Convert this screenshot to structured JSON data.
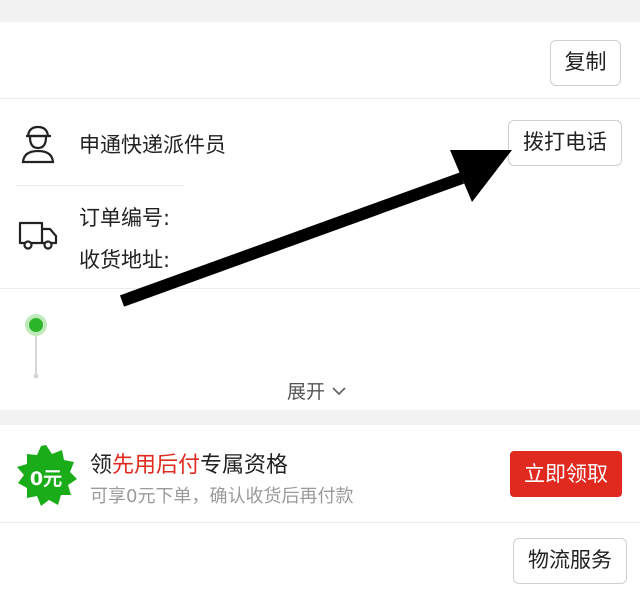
{
  "top_card": {
    "copy_label": "复制",
    "courier_label": "申通快递派件员",
    "call_label": "拨打电话",
    "order_no_label": "订单编号:",
    "address_label": "收货地址:",
    "expand_label": "展开"
  },
  "promo": {
    "badge_text": "0元",
    "title_prefix": "领",
    "title_highlight": "先用后付",
    "title_suffix": "专属资格",
    "subtitle": "可享0元下单，确认收货后再付款",
    "claim_label": "立即领取"
  },
  "footer": {
    "logistics_label": "物流服务"
  },
  "colors": {
    "accent_red": "#e02a20",
    "badge_green": "#1aad19",
    "status_green": "#2bb52b"
  },
  "icons": {
    "courier": "courier-person-icon",
    "truck": "delivery-truck-icon",
    "expand": "chevron-down-icon",
    "badge": "green-star-badge-icon"
  }
}
